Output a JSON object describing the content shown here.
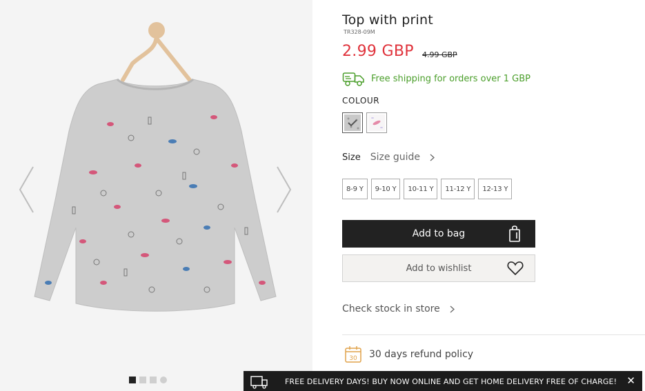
{
  "gallery": {
    "prev_icon": "chevron-left-icon",
    "next_icon": "chevron-right-icon",
    "image_alt": "grey long-sleeve top with print on a wooden hanger",
    "dots_count": 4,
    "active_dot": 0
  },
  "product": {
    "title": "Top with print",
    "sku": "TR328-09M",
    "price": "2.99 GBP",
    "old_price": "4.99 GBP",
    "price_color": "#e0333c"
  },
  "shipping": {
    "icon": "truck-icon",
    "text": "Free shipping for orders over 1 GBP",
    "color": "#4a9e2a"
  },
  "colour": {
    "label": "COLOUR",
    "swatches": [
      {
        "name": "grey",
        "color": "#c9c9c9",
        "selected": true
      },
      {
        "name": "white",
        "color": "#f7f5f6",
        "selected": false
      }
    ]
  },
  "size": {
    "label": "Size",
    "guide_label": "Size guide",
    "options": [
      "8-9 Y",
      "9-10 Y",
      "10-11 Y",
      "11-12 Y",
      "12-13 Y"
    ]
  },
  "actions": {
    "add_to_bag": "Add to bag",
    "add_to_wishlist": "Add to wishlist"
  },
  "store": {
    "check_stock": "Check stock in store"
  },
  "refund": {
    "icon_number": "30",
    "text": "30 days refund policy"
  },
  "banner": {
    "text": "FREE DELIVERY DAYS! BUY NOW ONLINE AND GET HOME DELIVERY FREE OF CHARGE!",
    "close": "✕"
  }
}
